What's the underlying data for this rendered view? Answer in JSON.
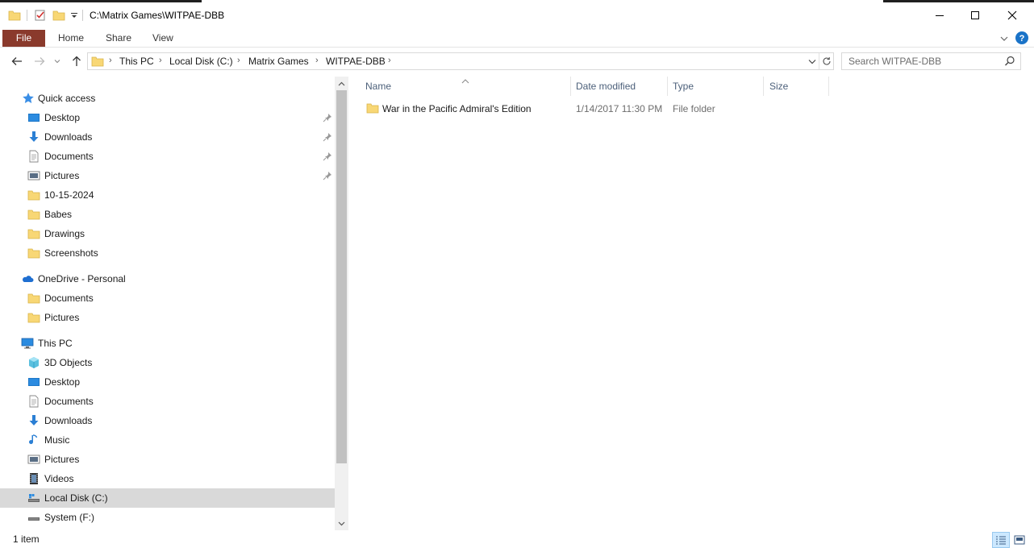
{
  "window": {
    "title": "C:\\Matrix Games\\WITPAE-DBB"
  },
  "ribbon": {
    "tabs": [
      "File",
      "Home",
      "Share",
      "View"
    ]
  },
  "address": {
    "crumbs": [
      "This PC",
      "Local Disk (C:)",
      "Matrix Games",
      "WITPAE-DBB"
    ]
  },
  "search": {
    "placeholder": "Search WITPAE-DBB"
  },
  "sidebar": {
    "quick_access": "Quick access",
    "quick_items": [
      "Desktop",
      "Downloads",
      "Documents",
      "Pictures",
      "10-15-2024",
      "Babes",
      "Drawings",
      "Screenshots"
    ],
    "onedrive": "OneDrive - Personal",
    "onedrive_items": [
      "Documents",
      "Pictures"
    ],
    "thispc": "This PC",
    "thispc_items": [
      "3D Objects",
      "Desktop",
      "Documents",
      "Downloads",
      "Music",
      "Pictures",
      "Videos",
      "Local Disk (C:)",
      "System (F:)"
    ]
  },
  "columns": {
    "name": "Name",
    "date": "Date modified",
    "type": "Type",
    "size": "Size"
  },
  "files": [
    {
      "name": "War in the Pacific Admiral's Edition",
      "date": "1/14/2017 11:30 PM",
      "type": "File folder",
      "size": ""
    }
  ],
  "status": {
    "count": "1 item"
  },
  "colors": {
    "file_tab": "#8a3a2c",
    "folder": "#f8d775",
    "selection": "#d9d9d9",
    "help": "#1a73c8"
  }
}
